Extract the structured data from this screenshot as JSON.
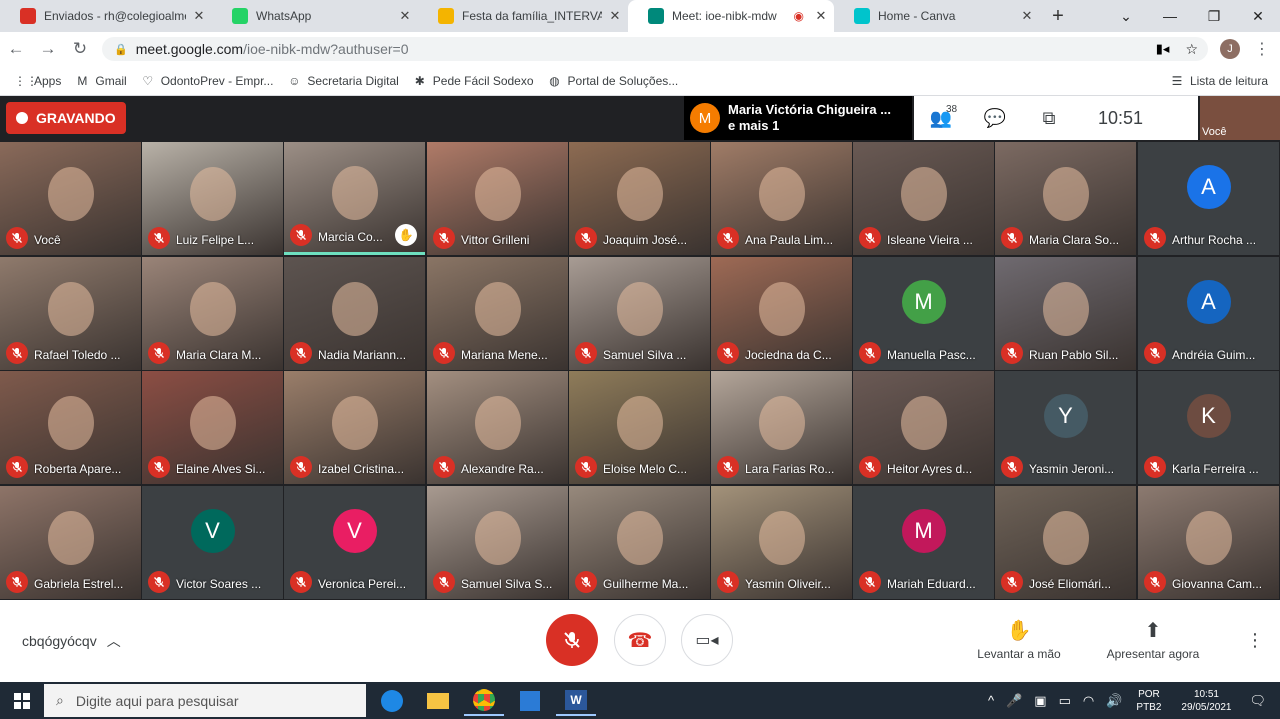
{
  "browser": {
    "tabs": [
      {
        "title": "Enviados - rh@colegioalmeid",
        "icon": "gmail-icon",
        "color": "#d93025"
      },
      {
        "title": "WhatsApp",
        "icon": "whatsapp-icon",
        "color": "#25d366"
      },
      {
        "title": "Festa da família_INTERVALO -",
        "icon": "slides-icon",
        "color": "#f4b400"
      },
      {
        "title": "Meet: ioe-nibk-mdw",
        "icon": "meet-icon",
        "color": "#00897b"
      },
      {
        "title": "Home - Canva",
        "icon": "canva-icon",
        "color": "#00c4cc"
      }
    ],
    "url_host": "meet.google.com",
    "url_path": "/ioe-nibk-mdw?authuser=0",
    "bookmarks": [
      {
        "label": "Apps",
        "icon": "apps-grid-icon"
      },
      {
        "label": "Gmail",
        "icon": "gmail-icon"
      },
      {
        "label": "OdontoPrev - Empr...",
        "icon": "shield-icon"
      },
      {
        "label": "Secretaria Digital",
        "icon": "person-icon"
      },
      {
        "label": "Pede Fácil Sodexo",
        "icon": "star-icon"
      },
      {
        "label": "Portal de Soluções...",
        "icon": "globe-icon"
      }
    ],
    "reading_list": "Lista de leitura",
    "profile_initial": "J"
  },
  "meet": {
    "recording_label": "GRAVANDO",
    "presenter": {
      "initial": "M",
      "line1": "Maria Victória Chigueira ...",
      "line2": "e mais 1"
    },
    "people_count": "38",
    "clock": "10:51",
    "self_label": "Você",
    "participants": [
      {
        "name": "Você",
        "kind": "video",
        "bg": "#8a6a5a"
      },
      {
        "name": "Luiz Felipe L...",
        "kind": "video",
        "bg": "#b9b2a8"
      },
      {
        "name": "Marcia Co...",
        "kind": "video",
        "bg": "#9c8f86",
        "hand": true,
        "active": true
      },
      {
        "name": "Vittor Grilleni",
        "kind": "video",
        "bg": "#b07b68"
      },
      {
        "name": "Joaquim José...",
        "kind": "video",
        "bg": "#8d6b52"
      },
      {
        "name": "Ana Paula Lim...",
        "kind": "video",
        "bg": "#a07c67"
      },
      {
        "name": "Isleane Vieira ...",
        "kind": "video",
        "bg": "#6a5a54"
      },
      {
        "name": "Maria Clara So...",
        "kind": "video",
        "bg": "#7c6a62"
      },
      {
        "name": "Arthur Rocha ...",
        "kind": "avatar",
        "initial": "A",
        "color": "#1a73e8"
      },
      {
        "name": "Rafael Toledo ...",
        "kind": "video",
        "bg": "#8f7a6c"
      },
      {
        "name": "Maria Clara M...",
        "kind": "video",
        "bg": "#9a8478"
      },
      {
        "name": "Nadia Mariann...",
        "kind": "video",
        "bg": "#5d5450"
      },
      {
        "name": "Mariana Mene...",
        "kind": "video",
        "bg": "#8a7565"
      },
      {
        "name": "Samuel Silva ...",
        "kind": "video",
        "bg": "#a89c94"
      },
      {
        "name": "Jociedna da C...",
        "kind": "video",
        "bg": "#9e6a55"
      },
      {
        "name": "Manuella Pasc...",
        "kind": "avatar",
        "initial": "M",
        "color": "#43a047"
      },
      {
        "name": "Ruan Pablo Sil...",
        "kind": "video",
        "bg": "#6f6a70"
      },
      {
        "name": "Andréia Guim...",
        "kind": "avatar",
        "initial": "A",
        "color": "#1565c0"
      },
      {
        "name": "Roberta Apare...",
        "kind": "video",
        "bg": "#7f5a4c"
      },
      {
        "name": "Elaine Alves Si...",
        "kind": "video",
        "bg": "#8c4e44"
      },
      {
        "name": "Izabel Cristina...",
        "kind": "video",
        "bg": "#9a7e6a"
      },
      {
        "name": "Alexandre Ra...",
        "kind": "video",
        "bg": "#a38f80"
      },
      {
        "name": "Eloise Melo C...",
        "kind": "video",
        "bg": "#8f7c5a"
      },
      {
        "name": "Lara Farias Ro...",
        "kind": "video",
        "bg": "#b4a69a"
      },
      {
        "name": "Heitor Ayres d...",
        "kind": "video",
        "bg": "#6b5a55"
      },
      {
        "name": "Yasmin Jeroni...",
        "kind": "avatar",
        "initial": "Y",
        "color": "#455a64"
      },
      {
        "name": "Karla Ferreira ...",
        "kind": "avatar",
        "initial": "K",
        "color": "#6d4c41"
      },
      {
        "name": "Gabriela Estrel...",
        "kind": "video",
        "bg": "#8e7468"
      },
      {
        "name": "Victor Soares ...",
        "kind": "avatar",
        "initial": "V",
        "color": "#00695c"
      },
      {
        "name": "Veronica Perei...",
        "kind": "avatar",
        "initial": "V",
        "color": "#e91e63"
      },
      {
        "name": "Samuel Silva S...",
        "kind": "video",
        "bg": "#a89a90"
      },
      {
        "name": "Guilherme Ma...",
        "kind": "video",
        "bg": "#97897c"
      },
      {
        "name": "Yasmin Oliveir...",
        "kind": "video",
        "bg": "#a3927a"
      },
      {
        "name": "Mariah Eduard...",
        "kind": "avatar",
        "initial": "M",
        "color": "#c2185b"
      },
      {
        "name": "José Eliomári...",
        "kind": "video",
        "bg": "#6f6358"
      },
      {
        "name": "Giovanna Cam...",
        "kind": "video",
        "bg": "#8c7a70"
      }
    ],
    "meeting_code": "cbqógyócqv",
    "raise_hand": "Levantar a mão",
    "present_now": "Apresentar agora"
  },
  "taskbar": {
    "search_placeholder": "Digite aqui para pesquisar",
    "lang1": "POR",
    "lang2": "PTB2",
    "time": "10:51",
    "date": "29/05/2021"
  }
}
